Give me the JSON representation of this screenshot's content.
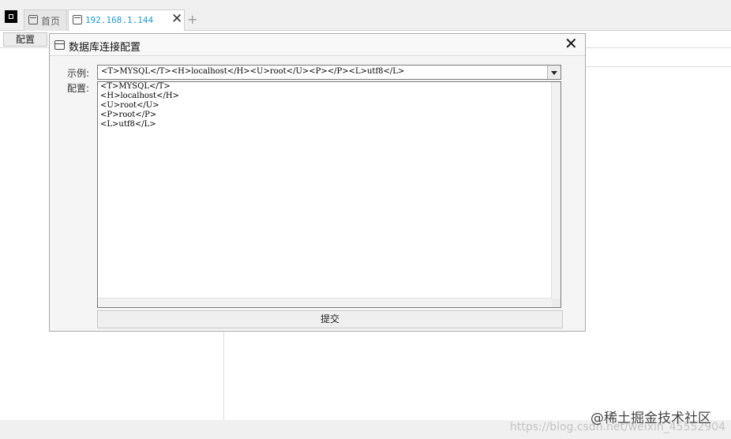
{
  "tabs": [
    {
      "label": "首页"
    },
    {
      "label": "192.168.1.144"
    }
  ],
  "tab_close": "✕",
  "tab_add": "+",
  "toolbar": {
    "config_label": "配置"
  },
  "dialog": {
    "title": "数据库连接配置",
    "close": "✕",
    "example_label": "示例:",
    "example_value": "<T>MYSQL</T><H>localhost</H><U>root</U><P></P><L>utf8</L>",
    "config_label": "配置:",
    "config_lines": "<T>MYSQL</T>\n<H>localhost</H>\n<U>root</U>\n<P>root</P>\n<L>utf8</L>",
    "submit_label": "提交"
  },
  "watermark": "https://blog.csdn.net/weixin_45552904",
  "brand": "@稀土掘金技术社区"
}
